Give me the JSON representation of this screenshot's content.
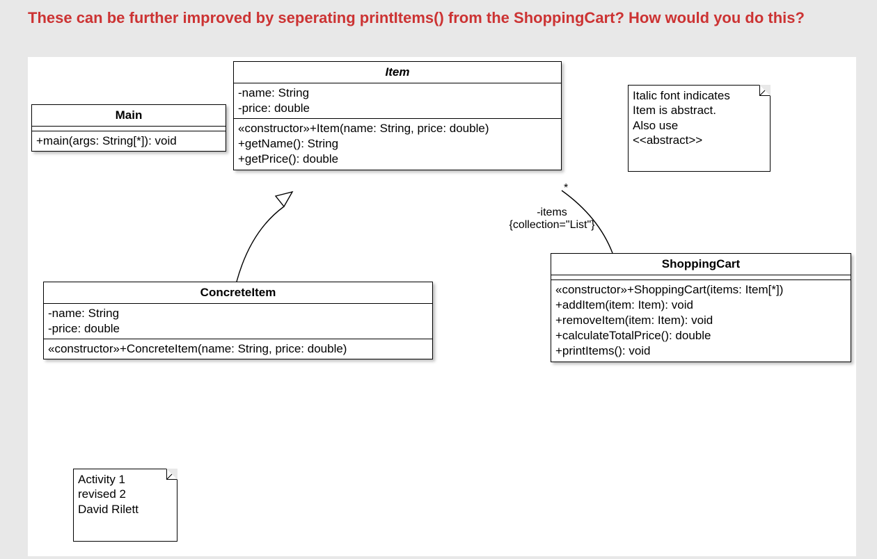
{
  "heading": "These can be further improved by seperating printItems() from the ShoppingCart?  How would you do this?",
  "classes": {
    "main": {
      "name": "Main",
      "ops": "+main(args: String[*]): void"
    },
    "item": {
      "name": "Item",
      "attr1": "-name: String",
      "attr2": "-price: double",
      "op1": "«constructor»+Item(name: String, price: double)",
      "op2": "+getName(): String",
      "op3": "+getPrice(): double"
    },
    "concrete": {
      "name": "ConcreteItem",
      "attr1": "-name: String",
      "attr2": "-price: double",
      "op1": "«constructor»+ConcreteItem(name: String, price: double)"
    },
    "cart": {
      "name": "ShoppingCart",
      "op1": "«constructor»+ShoppingCart(items: Item[*])",
      "op2": "+addItem(item: Item): void",
      "op3": "+removeItem(item: Item): void",
      "op4": "+calculateTotalPrice(): double",
      "op5": "+printItems(): void"
    }
  },
  "notes": {
    "abstract": {
      "l1": "Italic font indicates",
      "l2": "Item is abstract.",
      "l3": "Also use",
      "l4": "<<abstract>>"
    },
    "author": {
      "l1": "Activity 1",
      "l2": "revised 2",
      "l3": "David Rilett"
    }
  },
  "assoc": {
    "mult": "*",
    "role": "-items",
    "constraint": "{collection=\"List\"}"
  }
}
